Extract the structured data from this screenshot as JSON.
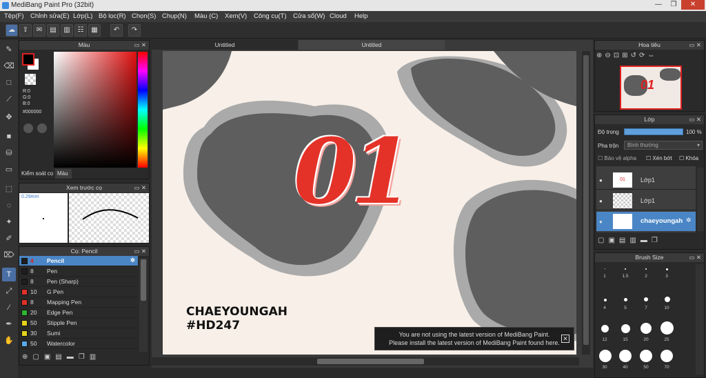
{
  "app": {
    "title": "MediBang Paint Pro (32bit)"
  },
  "menu": [
    "Tệp(F)",
    "Chỉnh sửa(E)",
    "Lớp(L)",
    "Bộ lọc(R)",
    "Chọn(S)",
    "Chụp(N)",
    "Màu (C)",
    "Xem(V)",
    "Công cụ(T)",
    "Cửa sổ(W)",
    "Cloud",
    "Help"
  ],
  "color_panel": {
    "title": "Màu",
    "r": "R:0",
    "g": "G:0",
    "b": "B:0",
    "hex": "#000000",
    "tab_brush": "Kiểm soát cọ",
    "tab_color": "Màu"
  },
  "preview_panel": {
    "title": "Xem trước cọ",
    "size": "0.29mm"
  },
  "brush_panel": {
    "title": "Cọ: Pencil",
    "items": [
      {
        "size": "4",
        "name": "Pencil",
        "color": "#1e1e1e"
      },
      {
        "size": "8",
        "name": "Pen",
        "color": "#1e1e1e"
      },
      {
        "size": "8",
        "name": "Pen (Sharp)",
        "color": "#1e1e1e"
      },
      {
        "size": "10",
        "name": "G Pen",
        "color": "#e0302a"
      },
      {
        "size": "8",
        "name": "Mapping Pen",
        "color": "#e0302a"
      },
      {
        "size": "20",
        "name": "Edge Pen",
        "color": "#2fb52f"
      },
      {
        "size": "50",
        "name": "Stipple Pen",
        "color": "#e6d21c"
      },
      {
        "size": "30",
        "name": "Sumi",
        "color": "#e6d21c"
      },
      {
        "size": "50",
        "name": "Watercolor",
        "color": "#5aa9e6"
      }
    ]
  },
  "tabs": [
    "Untitled",
    "Untitled"
  ],
  "canvas": {
    "big_text": "01",
    "line1": "CHAEYOUNGAH",
    "line2": "#HD247"
  },
  "navigator": {
    "title": "Hoa tiêu"
  },
  "layer_panel": {
    "title": "Lớp",
    "opacity_label": "Độ trong",
    "opacity_value": "100 %",
    "blend_label": "Pha trộn",
    "blend_value": "Bình thường",
    "protect_alpha": "Bảo vệ alpha",
    "clipping": "Xén bớt",
    "lock": "Khóa",
    "layers": [
      "Lớp1",
      "Lớp1",
      "chaeyoungah"
    ]
  },
  "brush_size": {
    "title": "Brush Size",
    "sizes": [
      "1",
      "1.5",
      "2",
      "3",
      "4",
      "5",
      "7",
      "10",
      "12",
      "15",
      "20",
      "25",
      "30",
      "40",
      "50",
      "70"
    ]
  },
  "notification": {
    "line1": "You are not using the latest version of MediBang Paint.",
    "line2": "Please install the latest version of MediBang Paint found here."
  }
}
